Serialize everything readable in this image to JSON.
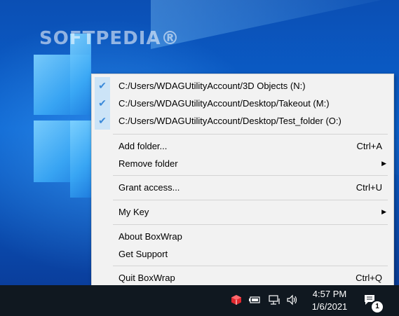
{
  "watermark": "SOFTPEDIA®",
  "menu": {
    "folders": [
      {
        "label": "C:/Users/WDAGUtilityAccount/3D Objects (N:)",
        "checked": true
      },
      {
        "label": "C:/Users/WDAGUtilityAccount/Desktop/Takeout (M:)",
        "checked": true
      },
      {
        "label": "C:/Users/WDAGUtilityAccount/Desktop/Test_folder (O:)",
        "checked": true
      }
    ],
    "add_folder": {
      "label": "Add folder...",
      "shortcut": "Ctrl+A"
    },
    "remove_folder": {
      "label": "Remove folder"
    },
    "grant_access": {
      "label": "Grant access...",
      "shortcut": "Ctrl+U"
    },
    "my_key": {
      "label": "My Key"
    },
    "about": {
      "label": "About BoxWrap"
    },
    "support": {
      "label": "Get Support"
    },
    "quit": {
      "label": "Quit BoxWrap",
      "shortcut": "Ctrl+Q"
    }
  },
  "check_glyph": "✔",
  "submenu_glyph": "▶",
  "taskbar": {
    "time": "4:57 PM",
    "date": "1/6/2021",
    "notification_count": "1"
  },
  "colors": {
    "menu_bg": "#f2f2f2",
    "check_bg": "#cce4f7",
    "check_color": "#3b8ad9",
    "taskbar_bg": "#101820",
    "boxwrap_tray": "#e0282e"
  }
}
